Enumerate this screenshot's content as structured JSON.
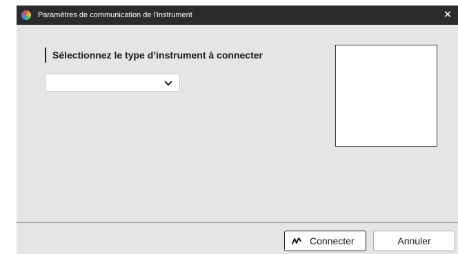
{
  "window": {
    "title": "Paramètres de communication de l’instrument",
    "app_icon": "color-wheel-icon",
    "close_glyph": "✕"
  },
  "main": {
    "heading": "Sélectionnez le type d’instrument à connecter",
    "instrument_select": {
      "value": "",
      "icon": "chevron-down-icon"
    }
  },
  "footer": {
    "connect_label": "Connecter",
    "connect_icon": "connection-signal-icon",
    "cancel_label": "Annuler"
  }
}
